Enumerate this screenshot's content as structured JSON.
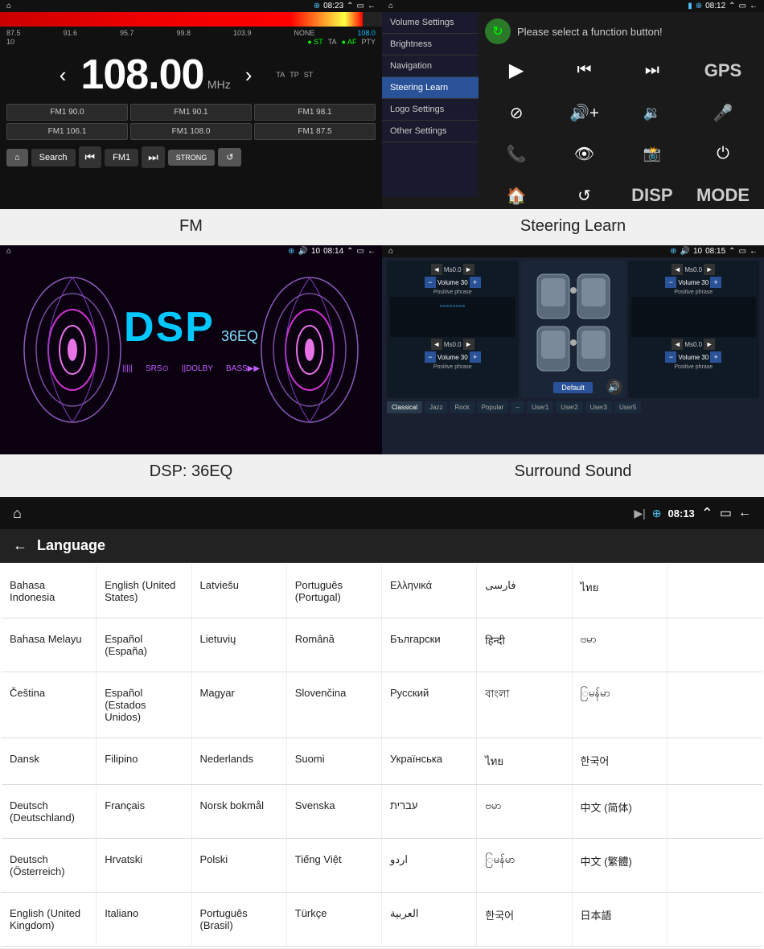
{
  "fm": {
    "label": "FM",
    "time": "08:23",
    "frequency": "108.00",
    "mhz": "MHz",
    "band": "FM1",
    "freq_markers": [
      "87.5",
      "91.6",
      "95.7",
      "99.8",
      "103.9",
      "NONE",
      "108.0"
    ],
    "status_items": [
      "ST",
      "TA",
      "AF",
      "PTY"
    ],
    "tp_row": [
      "TA",
      "TP",
      "ST"
    ],
    "presets": [
      "FM1 90.0",
      "FM1 90.1",
      "FM1 98.1",
      "FM1 106.1",
      "FM1 108.0",
      "FM1 87.5"
    ],
    "buttons": {
      "home": "⌂",
      "search": "Search",
      "prev": "⏮",
      "band": "FM1",
      "next": "⏭",
      "strong": "STRONG",
      "back": "↺"
    }
  },
  "steering_learn": {
    "label": "Steering Learn",
    "time": "08:12",
    "prompt": "Please select a function button!",
    "menu_items": [
      "Volume Settings",
      "Brightness",
      "Navigation",
      "Steering Learn",
      "Logo Settings",
      "Other Settings"
    ],
    "active_menu": "Steering Learn",
    "icons": [
      "▶",
      "⏮",
      "⏭",
      "GPS",
      "⊘",
      "🔊+",
      "🔊-",
      "🎤",
      "📞",
      "👁",
      "📸",
      "⏻",
      "🏠",
      "↺",
      "DISP",
      "MODE"
    ]
  },
  "dsp": {
    "label": "DSP: 36EQ",
    "time": "08:14",
    "volume": "10",
    "title": "DSP",
    "eq_label": "36EQ",
    "bottom_labels": [
      "|||||||",
      "SRS●",
      "||DOLBY",
      "BASS▶▶"
    ]
  },
  "surround_sound": {
    "label": "Surround Sound",
    "time": "08:15",
    "volume": "10",
    "tabs": [
      "Classical",
      "Jazz",
      "Rock",
      "Popular",
      "",
      "User1",
      "User2",
      "User3",
      "User5"
    ],
    "panels": [
      {
        "label": "Ms0.0",
        "volume": "Volume 30",
        "phrase": "Positive phrase"
      },
      {
        "label": "Ms0.0",
        "volume": "Volume 30",
        "phrase": "Positive phrase"
      },
      {
        "label": "Ms0.0",
        "volume": "Volume 30",
        "phrase": "Positive phrase"
      },
      {
        "label": "Ms0.0",
        "volume": "Volume 30",
        "phrase": "Positive phrase"
      }
    ],
    "center_btn": "Default"
  },
  "language": {
    "label": "Language",
    "time": "08:13",
    "back": "←",
    "rows": [
      [
        "Bahasa Indonesia",
        "English (United States)",
        "Latviešu",
        "Português (Portugal)",
        "Ελληνικά",
        "فارسی",
        "ไทย",
        ""
      ],
      [
        "Bahasa Melayu",
        "Español (España)",
        "Lietuvių",
        "Română",
        "Български",
        "हिन्दी",
        "ဗမာ",
        ""
      ],
      [
        "Čeština",
        "Español (Estados Unidos)",
        "Magyar",
        "Slovenčina",
        "Русский",
        "বাংলা",
        "ြမန်မာ",
        ""
      ],
      [
        "Dansk",
        "Filipino",
        "Nederlands",
        "Suomi",
        "Українська",
        "ไทย",
        "한국어",
        ""
      ],
      [
        "Deutsch (Deutschland)",
        "Français",
        "Norsk bokmål",
        "Svenska",
        "עברית",
        "ဗမာ",
        "中文 (简体)",
        ""
      ],
      [
        "Deutsch (Österreich)",
        "Hrvatski",
        "Polski",
        "Tiếng Việt",
        "اردو",
        "ြမန်မာ",
        "中文 (繁體)",
        ""
      ],
      [
        "English (United Kingdom)",
        "Italiano",
        "Português (Brasil)",
        "Türkçe",
        "العربية",
        "한국어",
        "日本語",
        ""
      ]
    ]
  }
}
